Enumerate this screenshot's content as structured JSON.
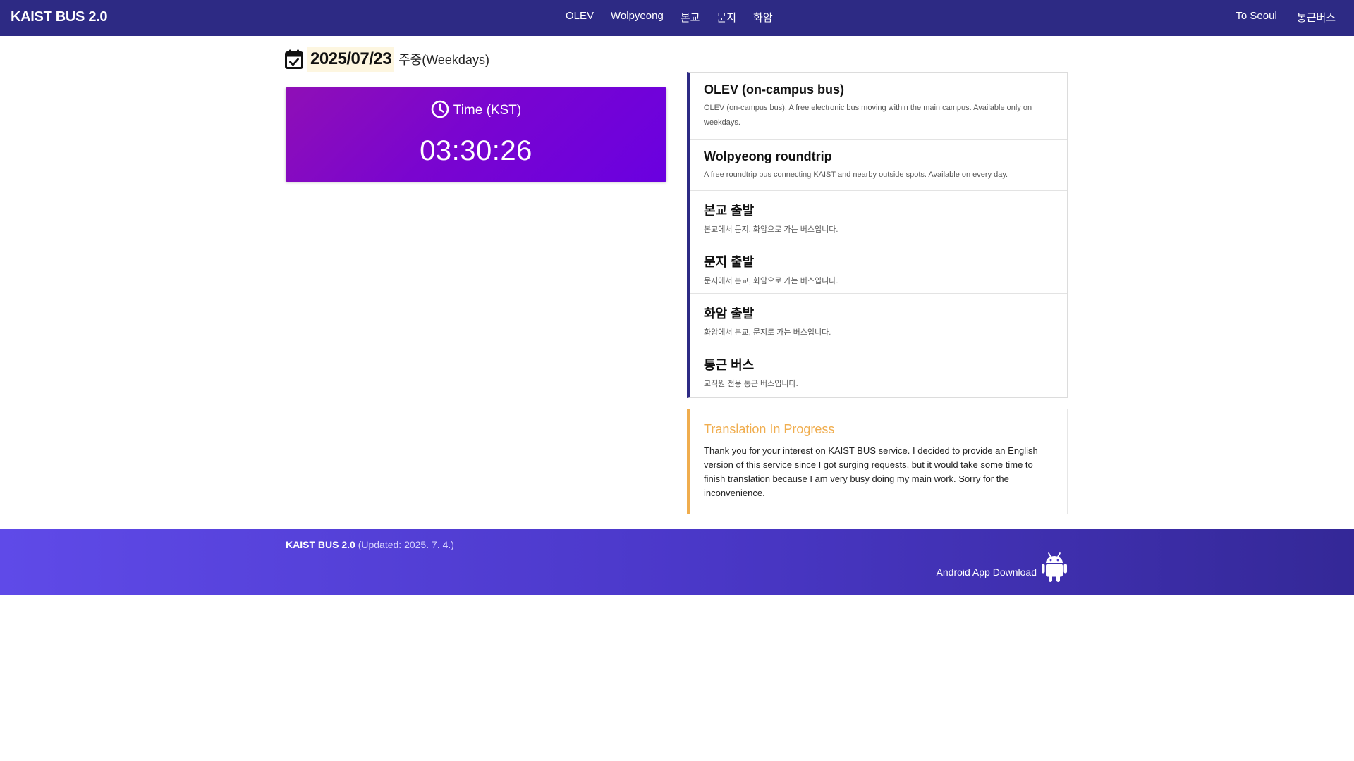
{
  "navbar": {
    "brand": "KAIST BUS 2.0",
    "center_links": [
      "OLEV",
      "Wolpyeong",
      "본교",
      "문지",
      "화암"
    ],
    "right_links": [
      "To Seoul",
      "통근버스"
    ]
  },
  "date_header": {
    "date": "2025/07/23",
    "day_type": "주중(Weekdays)",
    "icon": "calendar-check-icon"
  },
  "clock": {
    "title": "Time (KST)",
    "time": "03:30:26",
    "icon": "clock-icon"
  },
  "routes": [
    {
      "title": "OLEV (on-campus bus)",
      "desc": "OLEV (on-campus bus). A free electronic bus moving within the main campus. Available only on weekdays."
    },
    {
      "title": "Wolpyeong roundtrip",
      "desc": "A free roundtrip bus connecting KAIST and nearby outside spots. Available on every day."
    },
    {
      "title": "본교 출발",
      "desc": "본교에서 문지, 화암으로 가는 버스입니다."
    },
    {
      "title": "문지 출발",
      "desc": "문지에서 본교, 화암으로 가는 버스입니다."
    },
    {
      "title": "화암 출발",
      "desc": "화암에서 본교, 문지로 가는 버스입니다."
    },
    {
      "title": "통근 버스",
      "desc": "교직원 전용 통근 버스입니다."
    }
  ],
  "notice": {
    "title": "Translation In Progress",
    "body": "Thank you for your interest on KAIST BUS service. I decided to provide an English version of this service since I got surging requests, but it would take some time to finish translation because I am very busy doing my main work. Sorry for the inconvenience."
  },
  "footer": {
    "brand": "KAIST BUS 2.0",
    "updated": "(Updated: 2025. 7. 4.)",
    "app_download": "Android App Download",
    "icon": "android-icon"
  },
  "colors": {
    "navbar": "#2d2a84",
    "clock_gradient_start": "#8f0fb6",
    "clock_gradient_end": "#6a00e0",
    "route_accent": "#2d2a84",
    "notice_accent": "#f0ad4e",
    "footer_start": "#5f4ae8",
    "footer_end": "#342897",
    "date_highlight": "#fdf6e0"
  }
}
